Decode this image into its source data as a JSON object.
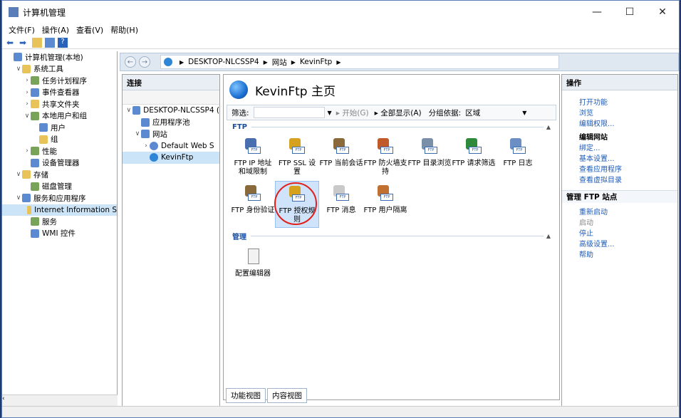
{
  "window": {
    "title": "计算机管理",
    "min": "—",
    "max": "☐",
    "close": "✕"
  },
  "menu": [
    "文件(F)",
    "操作(A)",
    "查看(V)",
    "帮助(H)"
  ],
  "tree": [
    {
      "label": "计算机管理(本地)",
      "exp": "",
      "indent": 0
    },
    {
      "label": "系统工具",
      "exp": "∨",
      "indent": 1
    },
    {
      "label": "任务计划程序",
      "exp": "›",
      "indent": 2
    },
    {
      "label": "事件查看器",
      "exp": "›",
      "indent": 2
    },
    {
      "label": "共享文件夹",
      "exp": "›",
      "indent": 2
    },
    {
      "label": "本地用户和组",
      "exp": "∨",
      "indent": 2
    },
    {
      "label": "用户",
      "exp": "",
      "indent": 3
    },
    {
      "label": "组",
      "exp": "",
      "indent": 3
    },
    {
      "label": "性能",
      "exp": "›",
      "indent": 2
    },
    {
      "label": "设备管理器",
      "exp": "",
      "indent": 2
    },
    {
      "label": "存储",
      "exp": "∨",
      "indent": 1
    },
    {
      "label": "磁盘管理",
      "exp": "",
      "indent": 2
    },
    {
      "label": "服务和应用程序",
      "exp": "∨",
      "indent": 1
    },
    {
      "label": "Internet Information S",
      "exp": "",
      "indent": 2,
      "sel": true
    },
    {
      "label": "服务",
      "exp": "",
      "indent": 2
    },
    {
      "label": "WMI 控件",
      "exp": "",
      "indent": 2
    }
  ],
  "breadcrumb": [
    "DESKTOP-NLCSSP4",
    "网站",
    "KevinFtp"
  ],
  "connections": {
    "title": "连接",
    "items": [
      {
        "label": "DESKTOP-NLCSSP4 (",
        "exp": "∨",
        "indent": 0
      },
      {
        "label": "应用程序池",
        "exp": "",
        "indent": 1
      },
      {
        "label": "网站",
        "exp": "∨",
        "indent": 1
      },
      {
        "label": "Default Web S",
        "exp": "›",
        "indent": 2
      },
      {
        "label": "KevinFtp",
        "exp": "",
        "indent": 2,
        "sel": true
      }
    ]
  },
  "center": {
    "title": "KevinFtp 主页",
    "filter_label": "筛选:",
    "start": "开始(G)",
    "showall": "全部显示(A)",
    "groupby": "分组依据:",
    "groupval": "区域",
    "group_ftp": "FTP",
    "group_manage": "管理",
    "features": [
      "FTP IP 地址和域限制",
      "FTP SSL 设置",
      "FTP 当前会话",
      "FTP 防火墙支持",
      "FTP 目录浏览",
      "FTP 请求筛选",
      "FTP 日志",
      "FTP 身份验证",
      "FTP 授权规则",
      "FTP 消息",
      "FTP 用户隔离"
    ],
    "manage_features": [
      "配置编辑器"
    ],
    "tab_features": "功能视图",
    "tab_content": "内容视图"
  },
  "actions": {
    "title": "操作",
    "items": [
      {
        "label": "打开功能",
        "style": "link"
      },
      {
        "label": "浏览",
        "style": "link"
      },
      {
        "label": "编辑权限...",
        "style": "link"
      },
      {
        "label": "编辑网站",
        "style": "bold"
      },
      {
        "label": "绑定...",
        "style": "link"
      },
      {
        "label": "基本设置...",
        "style": "link"
      },
      {
        "label": "查看应用程序",
        "style": "link"
      },
      {
        "label": "查看虚拟目录",
        "style": "link"
      }
    ],
    "manage_title": "管理 FTP 站点",
    "manage_items": [
      {
        "label": "重新启动",
        "style": "link"
      },
      {
        "label": "启动",
        "style": "dis"
      },
      {
        "label": "停止",
        "style": "link"
      },
      {
        "label": "高级设置...",
        "style": "link"
      },
      {
        "label": "帮助",
        "style": "link"
      }
    ]
  }
}
